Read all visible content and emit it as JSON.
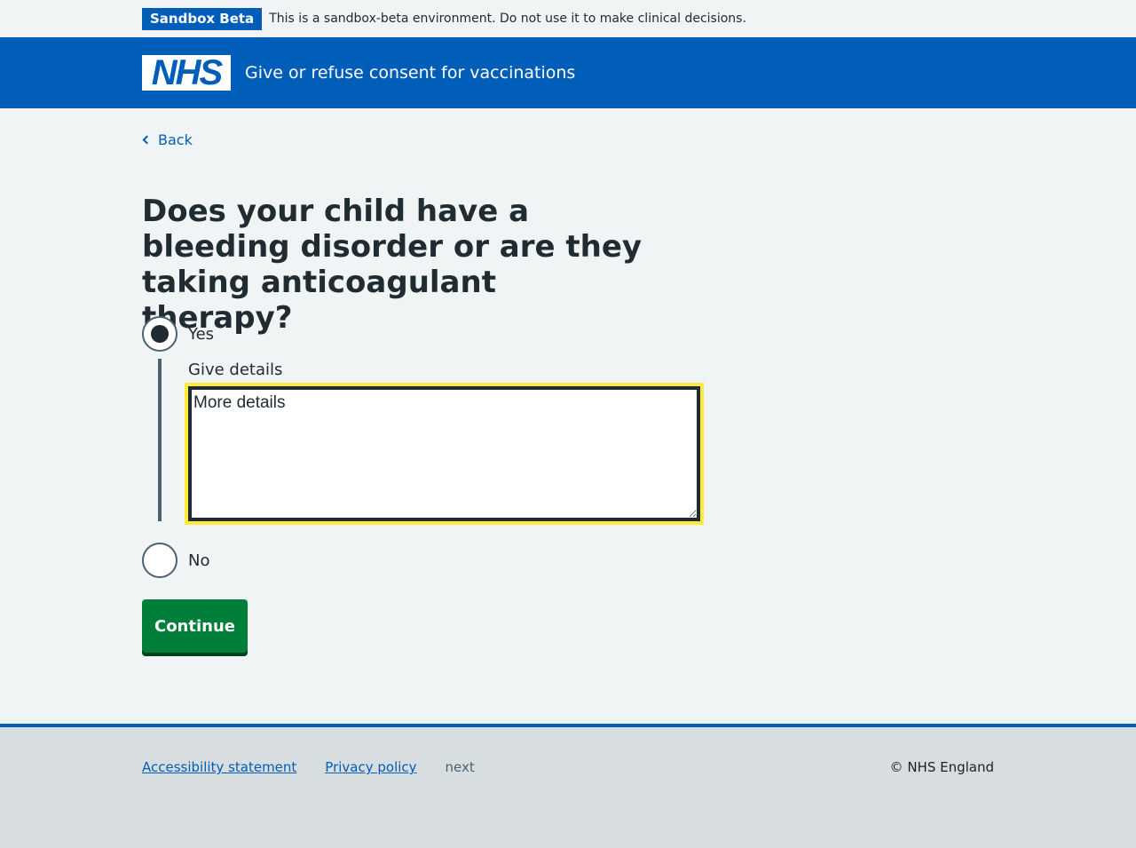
{
  "sandbox": {
    "tag": "Sandbox Beta",
    "message": "This is a sandbox-beta environment. Do not use it to make clinical decisions."
  },
  "header": {
    "logo_text": "NHS",
    "service_name": "Give or refuse consent for vaccinations",
    "brand_color": "#005eb8"
  },
  "main": {
    "back_label": "Back",
    "question": "Does your child have a bleeding disorder or are they taking anticoagulant therapy?",
    "options": [
      {
        "label": "Yes",
        "selected": true
      },
      {
        "label": "No",
        "selected": false
      }
    ],
    "details_label": "Give details",
    "details_value": "More details",
    "continue_label": "Continue",
    "continue_color": "#007f3b",
    "focus_color": "#ffeb3b"
  },
  "footer": {
    "links": [
      "Accessibility statement",
      "Privacy policy"
    ],
    "extra_text": "next",
    "copyright": "© NHS England"
  }
}
